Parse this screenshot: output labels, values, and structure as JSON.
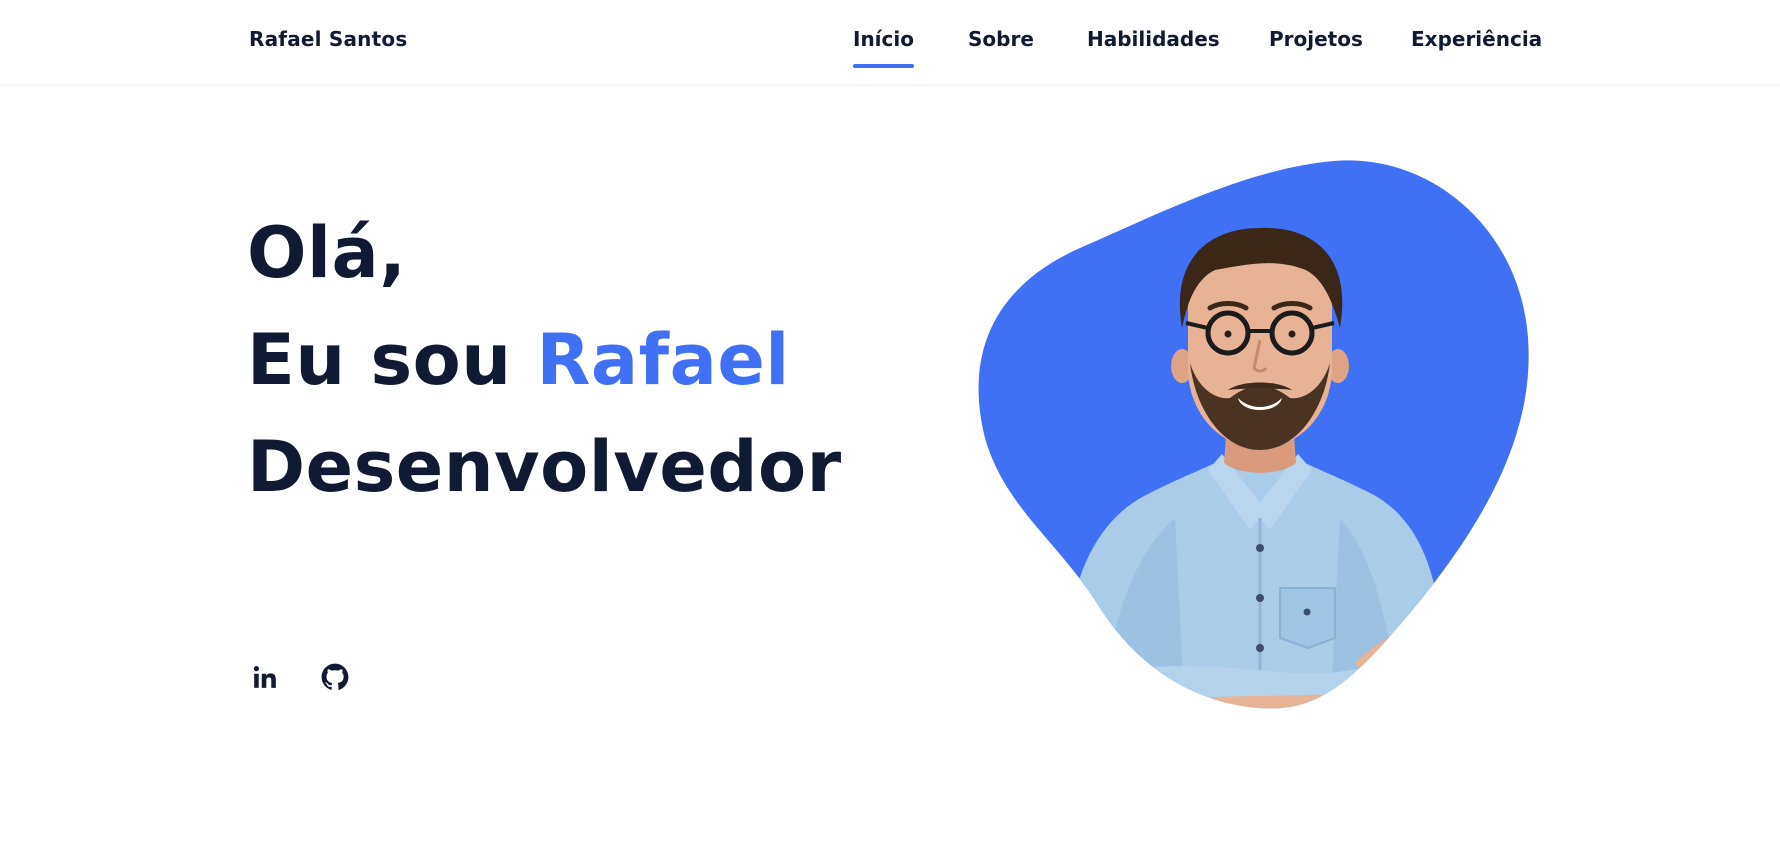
{
  "header": {
    "logo": "Rafael Santos",
    "nav": [
      {
        "label": "Início",
        "active": true
      },
      {
        "label": "Sobre",
        "active": false
      },
      {
        "label": "Habilidades",
        "active": false
      },
      {
        "label": "Projetos",
        "active": false
      },
      {
        "label": "Experiência",
        "active": false
      }
    ]
  },
  "hero": {
    "greeting": "Olá,",
    "intro": "Eu sou ",
    "name": "Rafael",
    "role": "Desenvolvedor"
  },
  "social": [
    {
      "icon": "linkedin-icon",
      "label": "in"
    },
    {
      "icon": "github-icon"
    }
  ],
  "colors": {
    "accent": "#4070f4",
    "text": "#101a33",
    "background": "#ffffff",
    "shirt": "#a9cce9"
  }
}
